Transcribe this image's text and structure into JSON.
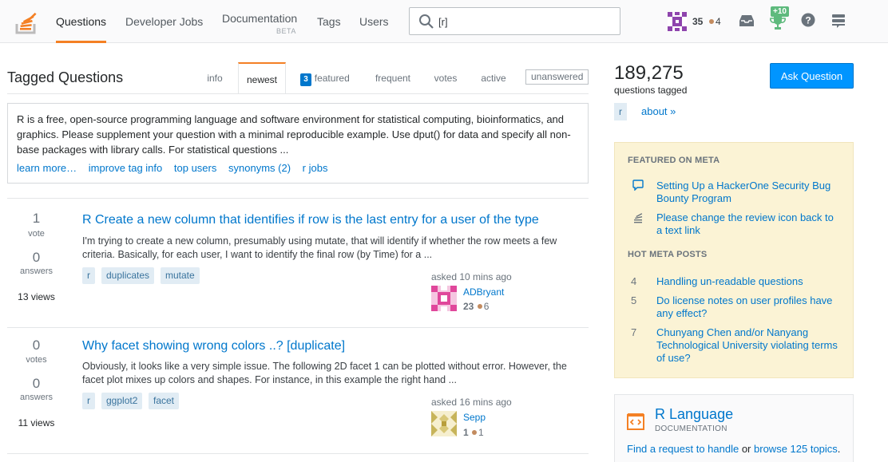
{
  "nav": {
    "items": [
      "Questions",
      "Developer Jobs",
      "Documentation",
      "Tags",
      "Users"
    ],
    "documentation_badge": "BETA",
    "search_value": "[r]"
  },
  "user": {
    "reputation": "35",
    "bronze": "4",
    "achievement_delta": "+10"
  },
  "page": {
    "title": "Tagged Questions",
    "tabs": [
      "info",
      "newest",
      "featured",
      "frequent",
      "votes",
      "active",
      "unanswered"
    ],
    "featured_count": "3"
  },
  "wiki": {
    "text": "R is a free, open-source programming language and software environment for statistical computing, bioinformatics, and graphics. Please supplement your question with a minimal reproducible example. Use dput() for data and specify all non-base packages with library calls. For statistical questions ...",
    "links": [
      "learn more…",
      "improve tag info",
      "top users",
      "synonyms (2)",
      "r jobs"
    ]
  },
  "questions": [
    {
      "votes": "1",
      "votes_label": "vote",
      "answers": "0",
      "answers_label": "answers",
      "views": "13 views",
      "title": "R Create a new column that identifies if row is the last entry for a user of the type",
      "excerpt": "I'm trying to create a new column, presumably using mutate, that will identify if whether the row meets a few criteria. Basically, for each user, I want to identify the final row (by Time) for a ...",
      "tags": [
        "r",
        "duplicates",
        "mutate"
      ],
      "asked": "asked 10 mins ago",
      "user": "ADBryant",
      "rep": "23",
      "bronze": "6"
    },
    {
      "votes": "0",
      "votes_label": "votes",
      "answers": "0",
      "answers_label": "answers",
      "views": "11 views",
      "title": "Why facet showing wrong colors ..? [duplicate]",
      "excerpt": "Obviously, it looks like a very simple issue. The following 2D facet 1 can be plotted without error. However, the facet plot mixes up colors and shapes. For instance, in this example the right hand ...",
      "tags": [
        "r",
        "ggplot2",
        "facet"
      ],
      "asked": "asked 16 mins ago",
      "user": "Sepp",
      "rep": "1",
      "bronze": "1"
    }
  ],
  "sidebar": {
    "count": "189,275",
    "count_label": "questions tagged",
    "ask_button": "Ask Question",
    "tag": "r",
    "about": "about »",
    "featured_meta_heading": "FEATURED ON META",
    "featured_meta": [
      "Setting Up a HackerOne Security Bug Bounty Program",
      "Please change the review icon back to a text link"
    ],
    "hot_meta_heading": "HOT META POSTS",
    "hot_meta": [
      {
        "num": "4",
        "text": "Handling un-readable questions"
      },
      {
        "num": "5",
        "text": "Do license notes on user profiles have any effect?"
      },
      {
        "num": "7",
        "text": "Chunyang Chen and/or Nanyang Technological University violating terms of use?"
      }
    ],
    "rlang": {
      "title": "R Language",
      "subtitle": "DOCUMENTATION",
      "link1": "Find a request to handle",
      "or": " or ",
      "link2": "browse 125 topics",
      "end": "."
    }
  },
  "colors": {
    "accent": "#f48024",
    "link": "#0077cc",
    "tag_bg": "#e1ecf4",
    "button": "#0095ff",
    "meta_bg": "#fbf3d5"
  }
}
